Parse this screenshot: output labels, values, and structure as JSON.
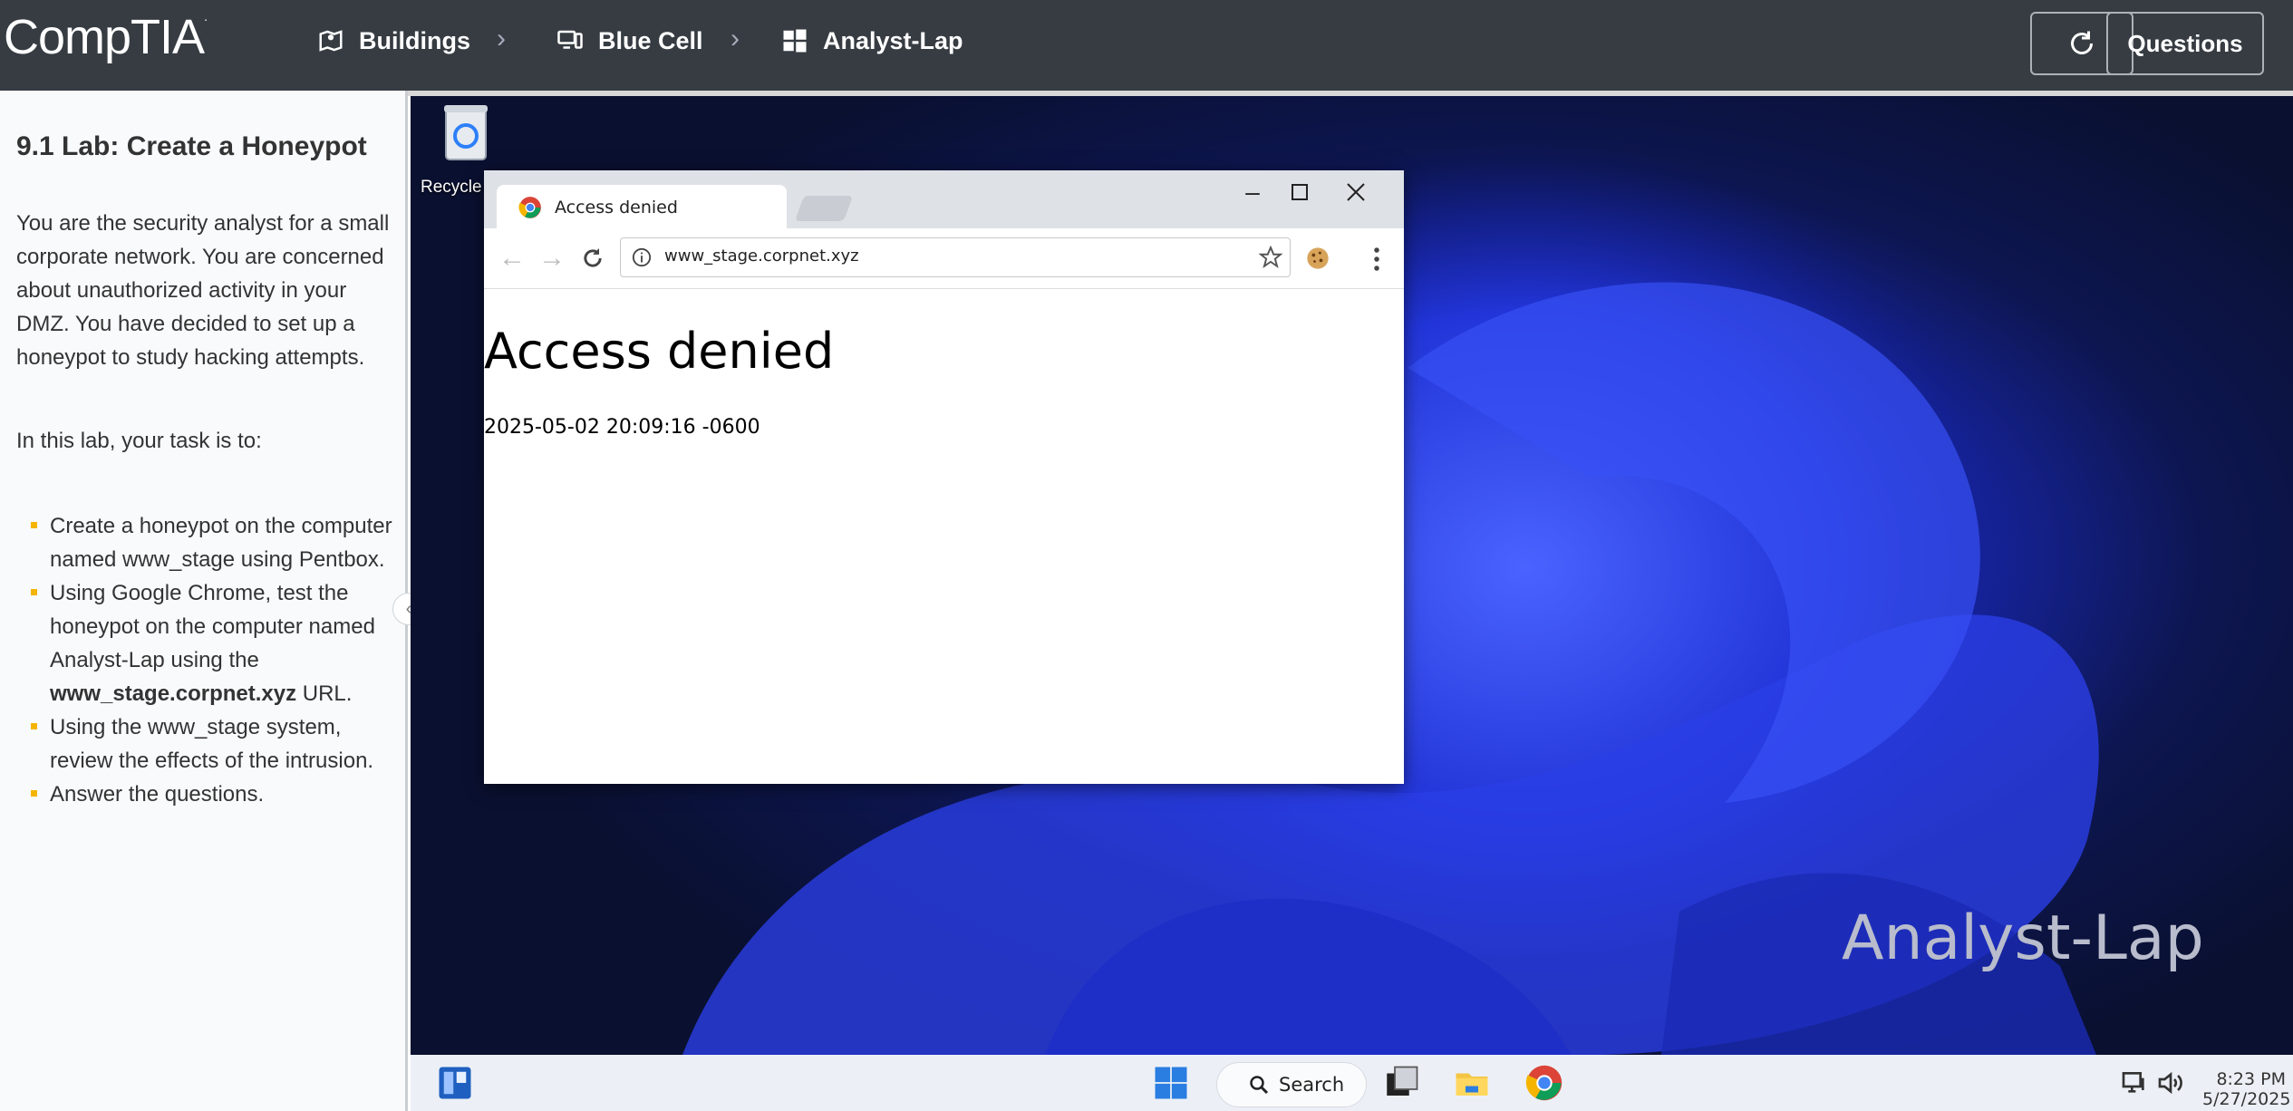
{
  "topbar": {
    "logo": "CompTIA",
    "breadcrumbs": [
      {
        "label": "Buildings",
        "icon": "building-map-icon"
      },
      {
        "label": "Blue Cell",
        "icon": "computers-icon"
      },
      {
        "label": "Analyst-Lap",
        "icon": "windows-icon"
      }
    ],
    "separator": "›",
    "refresh_icon": "refresh-icon",
    "questions_label": "Questions"
  },
  "lab": {
    "title": "9.1 Lab: Create a Honeypot",
    "intro": "You are the security analyst for a small corporate network. You are concerned about unauthorized activity in your DMZ. You have decided to set up a honeypot to study hacking attempts.",
    "task_intro": "In this lab, your task is to:",
    "tasks": [
      {
        "text": "Create a honeypot on the computer named www_stage using Pentbox."
      },
      {
        "pre": "Using Google Chrome, test the honeypot on the computer named Analyst-Lap using the ",
        "bold": "www_stage.corpnet.xyz",
        "post": " URL."
      },
      {
        "text": "Using the www_stage system, review the effects of the intrusion."
      },
      {
        "text": "Answer the questions."
      }
    ]
  },
  "desktop": {
    "recycle_label": "Recycle",
    "watermark": "Analyst-Lap"
  },
  "browser": {
    "tab_title": "Access denied",
    "url": "www_stage.corpnet.xyz",
    "page_heading": "Access denied",
    "page_timestamp": "2025-05-02 20:09:16 -0600"
  },
  "taskbar": {
    "search_label": "Search",
    "time": "8:23 PM",
    "date": "5/27/2025"
  },
  "colors": {
    "topbar": "#363c42",
    "bullet": "#f5b400",
    "desktop_blue": "#1f2fc4"
  }
}
